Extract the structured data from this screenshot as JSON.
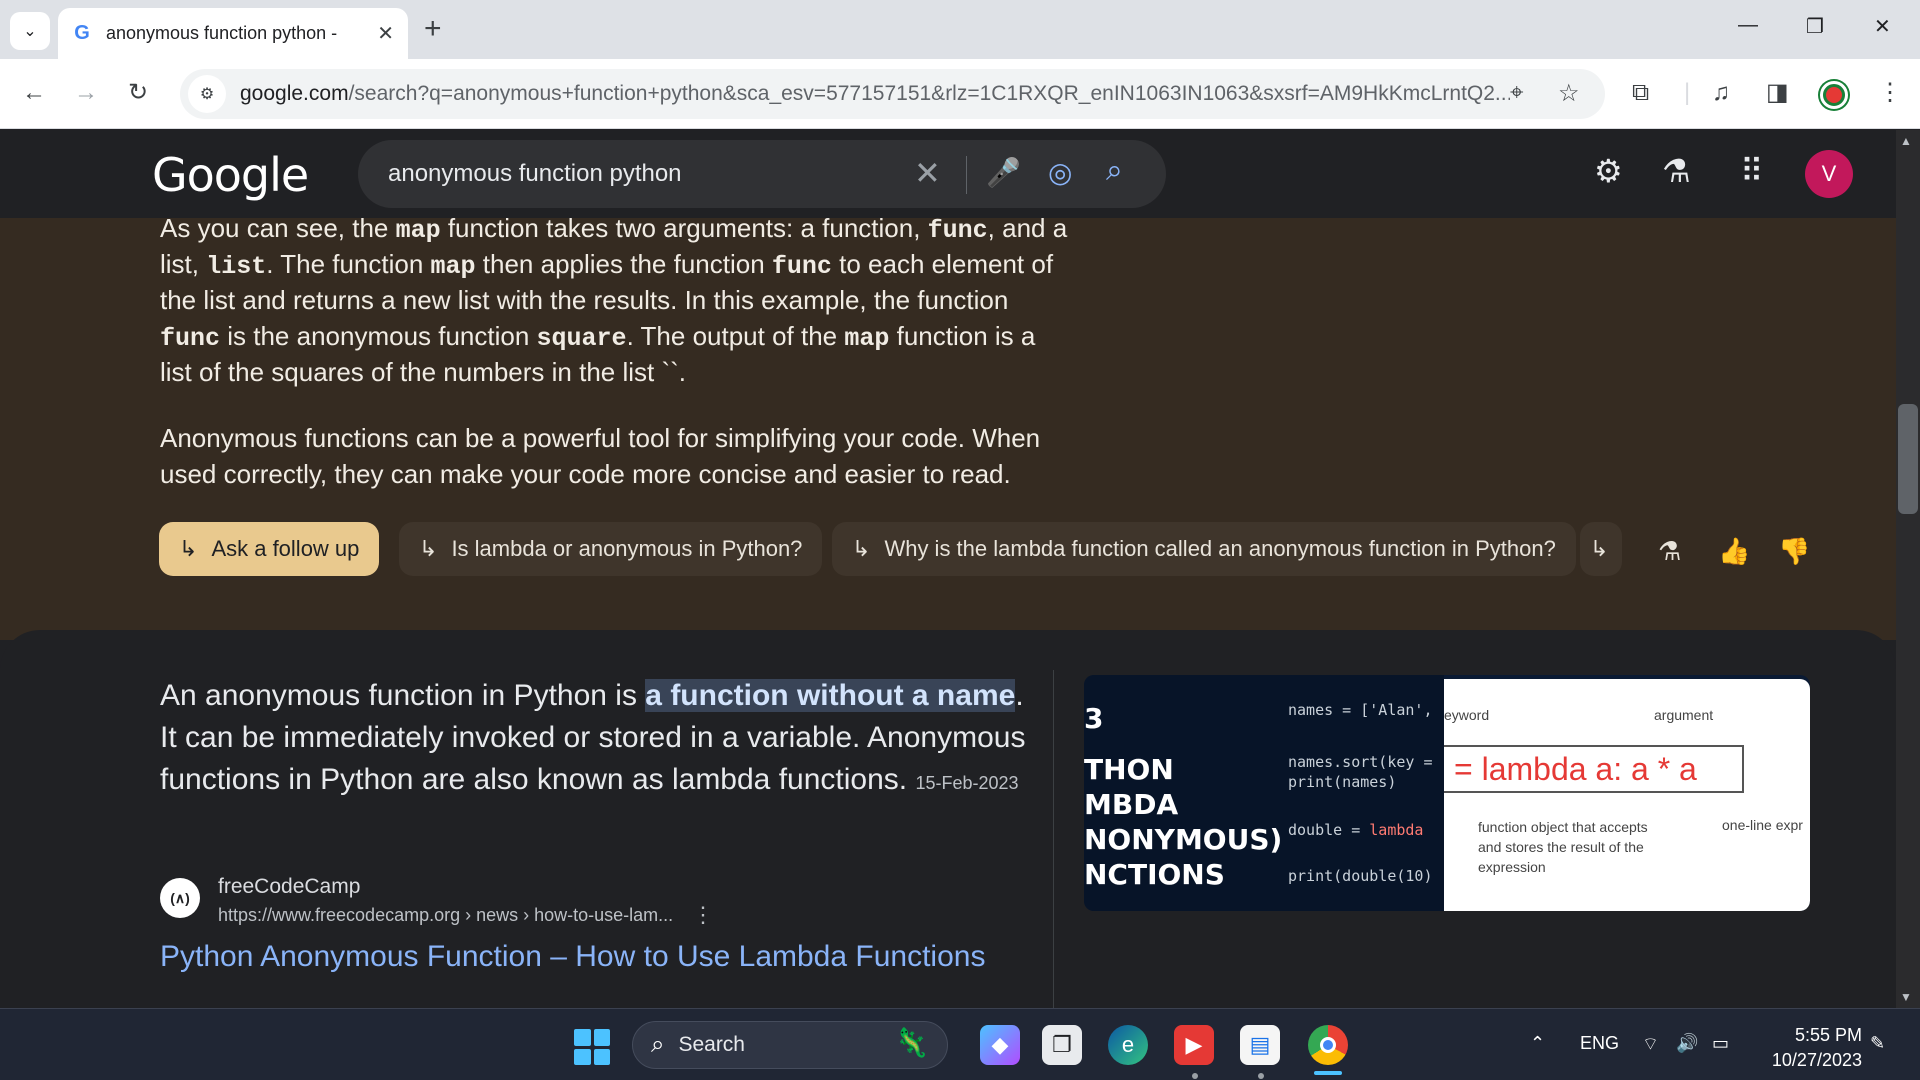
{
  "browser": {
    "tab_title": "anonymous function python -",
    "tab_favicon": "G",
    "new_tab_label": "+",
    "url_host": "google.com",
    "url_rest": "/search?q=anonymous+function+python&sca_esv=577157151&rlz=1C1RXQR_enIN1063IN1063&sxsrf=AM9HkKmcLrntQ2..."
  },
  "google": {
    "logo": "Google",
    "query": "anonymous function python",
    "avatar_letter": "V"
  },
  "ai_overview": {
    "para1_lines": [
      {
        "pre": "As you can see, the ",
        "c1": "map",
        "mid": " function takes two arguments: a function, ",
        "c2": "func",
        "post": ", and a"
      },
      {
        "pre": "list, ",
        "c1": "list",
        "mid": ". The function ",
        "c2": "map",
        "post": " then applies the function "
      },
      {
        "pre": "the list and returns a new list with the results. In this example, the function",
        "c1": "",
        "mid": "",
        "c2": "",
        "post": ""
      },
      {
        "pre": "",
        "c1": "func",
        "mid": " is the anonymous function ",
        "c2": "square",
        "post": ". The output of the "
      },
      {
        "pre": "list of the squares of the numbers in the list ``.",
        "c1": "",
        "mid": "",
        "c2": "",
        "post": ""
      }
    ],
    "line2_c3": "func",
    "line2_tail": " to each element of",
    "line4_c3": "map",
    "line4_tail": " function is a",
    "para2_line1": "Anonymous functions can be a powerful tool for simplifying your code. When",
    "para2_line2": "used correctly, they can make your code more concise and easier to read.",
    "chips": [
      "Ask a follow up",
      "Is lambda or anonymous in Python?",
      "Why is the lambda function called an anonymous function in Python?"
    ]
  },
  "snippet": {
    "text_pre": "An anonymous function in Python is ",
    "highlight": "a function without a name",
    "text_post": ". It can be immediately invoked or stored in a variable. Anonymous functions in Python are also known as lambda functions. ",
    "date": "15-Feb-2023",
    "source_name": "freeCodeCamp",
    "source_url": "https://www.freecodecamp.org › news › how-to-use-lam...",
    "link_title": "Python Anonymous Function – How to Use Lambda Functions",
    "image": {
      "title_lines": [
        "3",
        "THON",
        "MBDA",
        "NONYMOUS)",
        "NCTIONS"
      ],
      "code1": "names = ['Alan',",
      "code2": "names.sort(key =",
      "code3": "print(names)",
      "code4a": "double = ",
      "code4b": "lambda",
      "code5": "print(double(10)",
      "keyword_label": "eyword",
      "argument_label": "argument",
      "lambda_expr": "= lambda a: a * a",
      "note1": "function object that accepts",
      "note2": "and stores the result of the",
      "note3": "expression",
      "note4": "one-line expr"
    }
  },
  "taskbar": {
    "search_label": "Search",
    "lang": "ENG",
    "time": "5:55 PM",
    "date": "10/27/2023"
  }
}
